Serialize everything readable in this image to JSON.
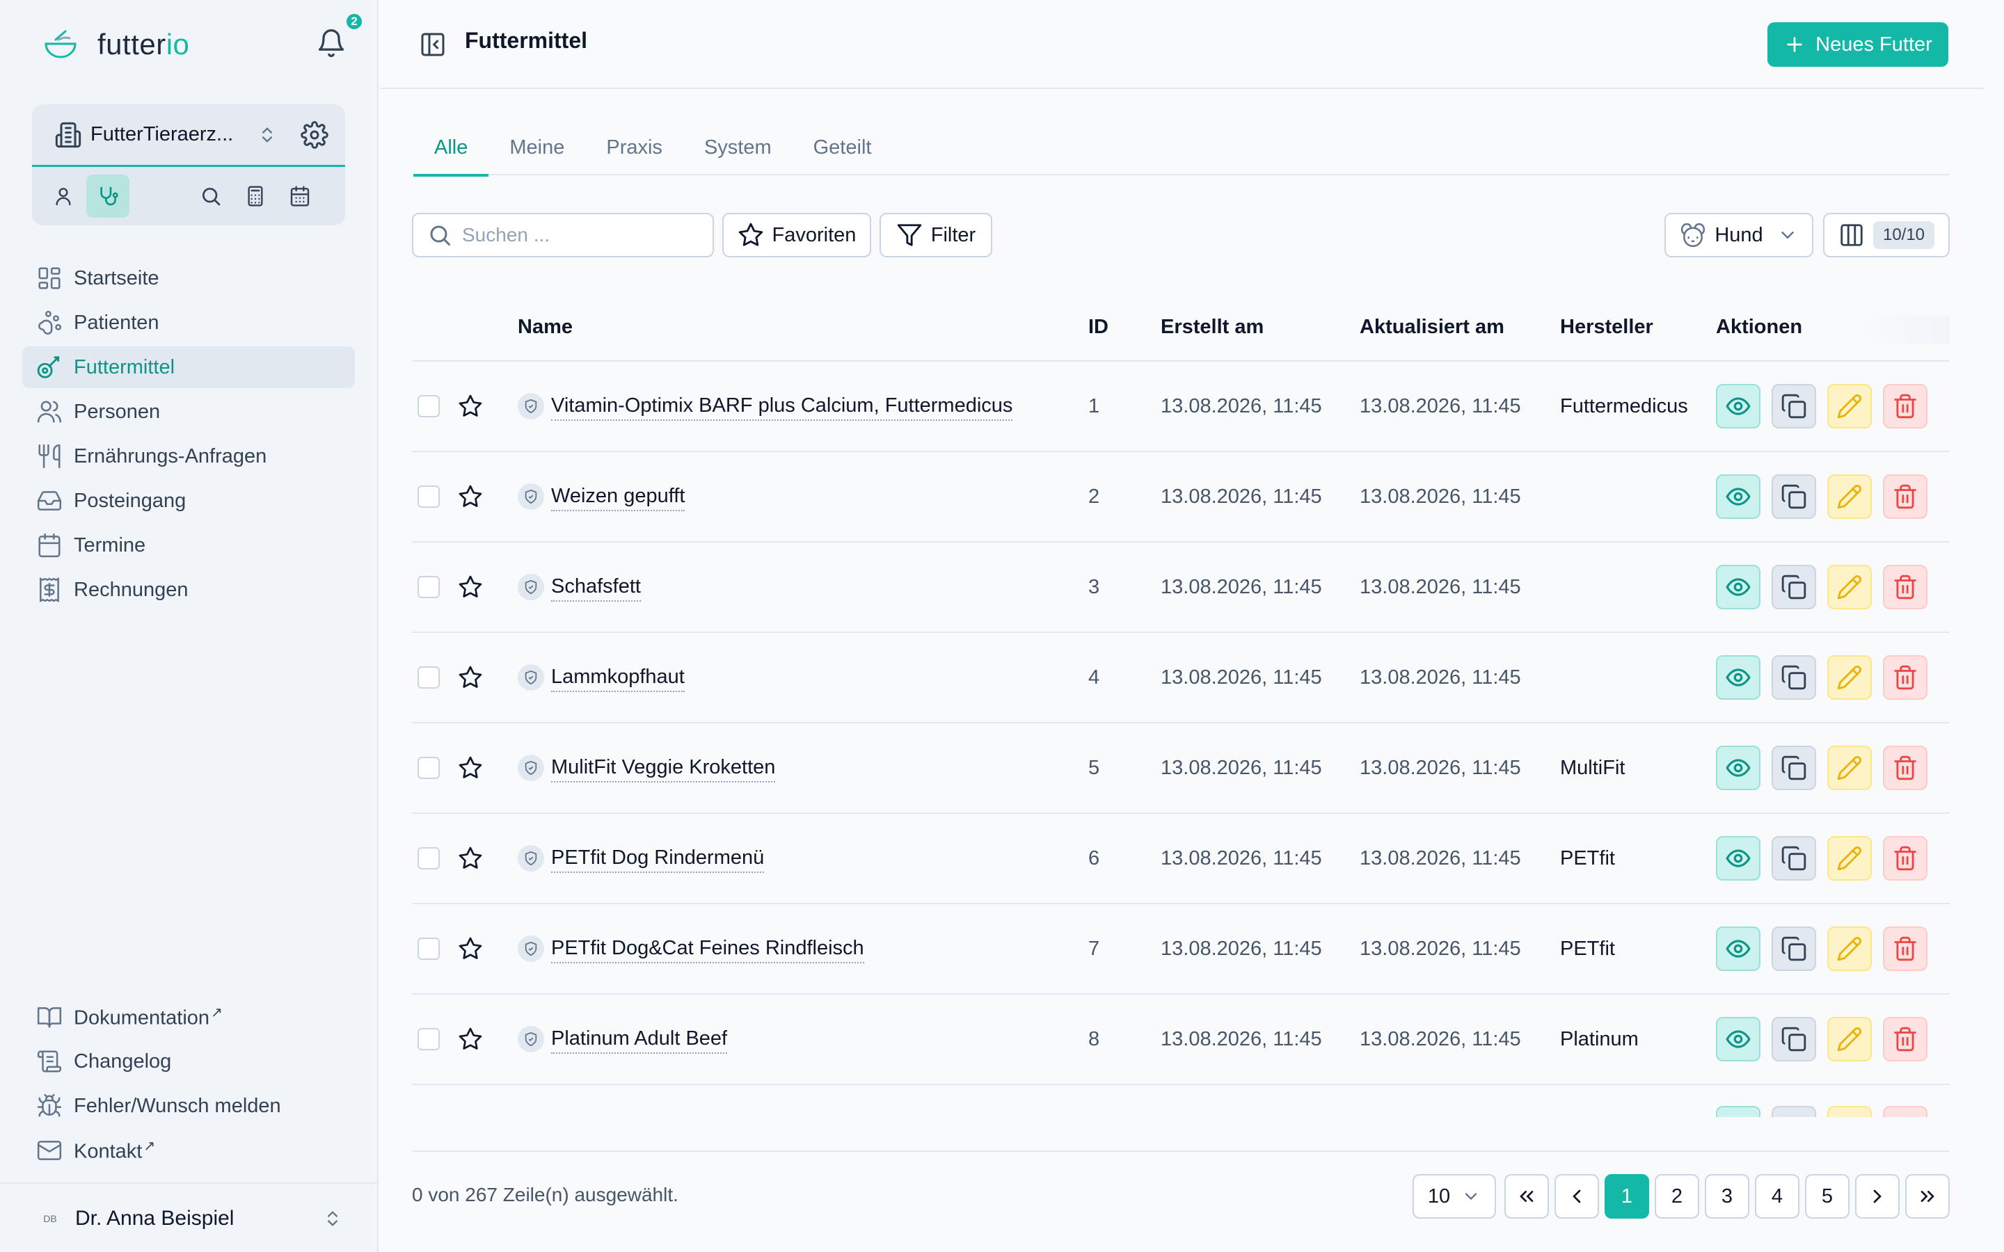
{
  "app": {
    "logo_text": "futter",
    "logo_accent": "io",
    "notification_count": "2"
  },
  "org": {
    "name": "FutterTieraerz..."
  },
  "sidebar": {
    "items": [
      {
        "label": "Startseite",
        "icon": "dashboard-icon"
      },
      {
        "label": "Patienten",
        "icon": "paw-icon"
      },
      {
        "label": "Futtermittel",
        "icon": "food-icon",
        "active": true
      },
      {
        "label": "Personen",
        "icon": "users-icon"
      },
      {
        "label": "Ernährungs-Anfragen",
        "icon": "utensils-icon"
      },
      {
        "label": "Posteingang",
        "icon": "inbox-icon"
      },
      {
        "label": "Termine",
        "icon": "calendar-icon"
      },
      {
        "label": "Rechnungen",
        "icon": "invoice-icon"
      }
    ],
    "bottom_items": [
      {
        "label": "Dokumentation",
        "external": "↗",
        "icon": "book-icon"
      },
      {
        "label": "Changelog",
        "icon": "scroll-icon"
      },
      {
        "label": "Fehler/Wunsch melden",
        "icon": "bug-icon"
      },
      {
        "label": "Kontakt",
        "external": "↗",
        "icon": "mail-icon"
      }
    ],
    "user": {
      "initials": "DB",
      "name": "Dr. Anna Beispiel"
    }
  },
  "header": {
    "title": "Futtermittel",
    "new_button": "Neues Futter"
  },
  "tabs": [
    "Alle",
    "Meine",
    "Praxis",
    "System",
    "Geteilt"
  ],
  "toolbar": {
    "search_placeholder": "Suchen ...",
    "favorites": "Favoriten",
    "filter": "Filter",
    "species": "Hund",
    "columns": "10/10"
  },
  "table": {
    "headers": {
      "name": "Name",
      "id": "ID",
      "created": "Erstellt am",
      "updated": "Aktualisiert am",
      "manufacturer": "Hersteller",
      "actions": "Aktionen"
    },
    "rows": [
      {
        "name": "Vitamin-Optimix BARF plus Calcium, Futtermedicus",
        "id": "1",
        "created": "13.08.2026, 11:45",
        "updated": "13.08.2026, 11:45",
        "manufacturer": "Futtermedicus"
      },
      {
        "name": "Weizen gepufft",
        "id": "2",
        "created": "13.08.2026, 11:45",
        "updated": "13.08.2026, 11:45",
        "manufacturer": ""
      },
      {
        "name": "Schafsfett",
        "id": "3",
        "created": "13.08.2026, 11:45",
        "updated": "13.08.2026, 11:45",
        "manufacturer": ""
      },
      {
        "name": "Lammkopfhaut",
        "id": "4",
        "created": "13.08.2026, 11:45",
        "updated": "13.08.2026, 11:45",
        "manufacturer": ""
      },
      {
        "name": "MulitFit Veggie Kroketten",
        "id": "5",
        "created": "13.08.2026, 11:45",
        "updated": "13.08.2026, 11:45",
        "manufacturer": "MultiFit"
      },
      {
        "name": "PETfit Dog Rindermenü",
        "id": "6",
        "created": "13.08.2026, 11:45",
        "updated": "13.08.2026, 11:45",
        "manufacturer": "PETfit"
      },
      {
        "name": "PETfit Dog&Cat Feines Rindfleisch",
        "id": "7",
        "created": "13.08.2026, 11:45",
        "updated": "13.08.2026, 11:45",
        "manufacturer": "PETfit"
      },
      {
        "name": "Platinum Adult Beef",
        "id": "8",
        "created": "13.08.2026, 11:45",
        "updated": "13.08.2026, 11:45",
        "manufacturer": "Platinum"
      }
    ]
  },
  "footer": {
    "selection": "0 von 267 Zeile(n) ausgewählt.",
    "page_size": "10",
    "pages": [
      "1",
      "2",
      "3",
      "4",
      "5"
    ],
    "current_page": "1"
  },
  "colors": {
    "accent": "#14b8a6",
    "accent_dark": "#0d9488",
    "sidebar_bg": "#f1f5f9"
  }
}
